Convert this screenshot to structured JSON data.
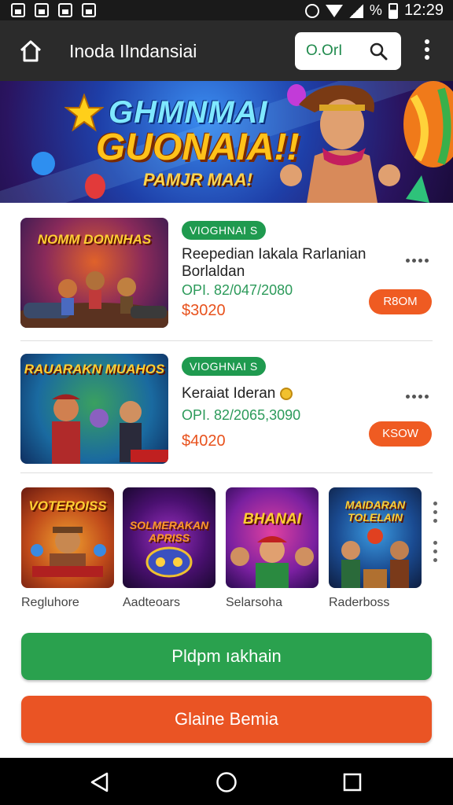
{
  "status_bar": {
    "time": "12:29",
    "battery": "%"
  },
  "app_bar": {
    "title": "Inoda IIndansiai",
    "search_value": "O.OrI"
  },
  "banner": {
    "title_line1": "GHMNMAI",
    "title_line2": "GUONAIA!!",
    "subtitle": "PAMJR MAA!"
  },
  "games": [
    {
      "thumb_title": "NOMM DONNHAS",
      "badge": "VIOGHNAI S",
      "title": "Reepedian Iakala Rarlanian Borlaldan",
      "subtitle": "OPI. 82/047/2080",
      "price": "$3020",
      "button": "R8OM"
    },
    {
      "thumb_title": "RAUARAKN MUAHOS",
      "badge": "VIOGHNAI S",
      "title": "Keraiat Ideran",
      "subtitle": "OPI. 82/2065,3090",
      "price": "$4020",
      "button": "KSOW"
    }
  ],
  "tiles": [
    {
      "title": "VOTEROISS",
      "label": "Regluhore"
    },
    {
      "title": "SOLMERAKAN APRISS",
      "label": "Aadteoars"
    },
    {
      "title": "BHANAI",
      "label": "Selarsoha"
    },
    {
      "title": "MAIDARAN TOLELAIN",
      "label": "Raderboss"
    }
  ],
  "buttons": {
    "primary": "Pldpm ıakhain",
    "secondary": "Glaine Bemia"
  },
  "colors": {
    "green": "#2aa14e",
    "orange": "#ea5424",
    "appbar": "#2b2b2b"
  }
}
